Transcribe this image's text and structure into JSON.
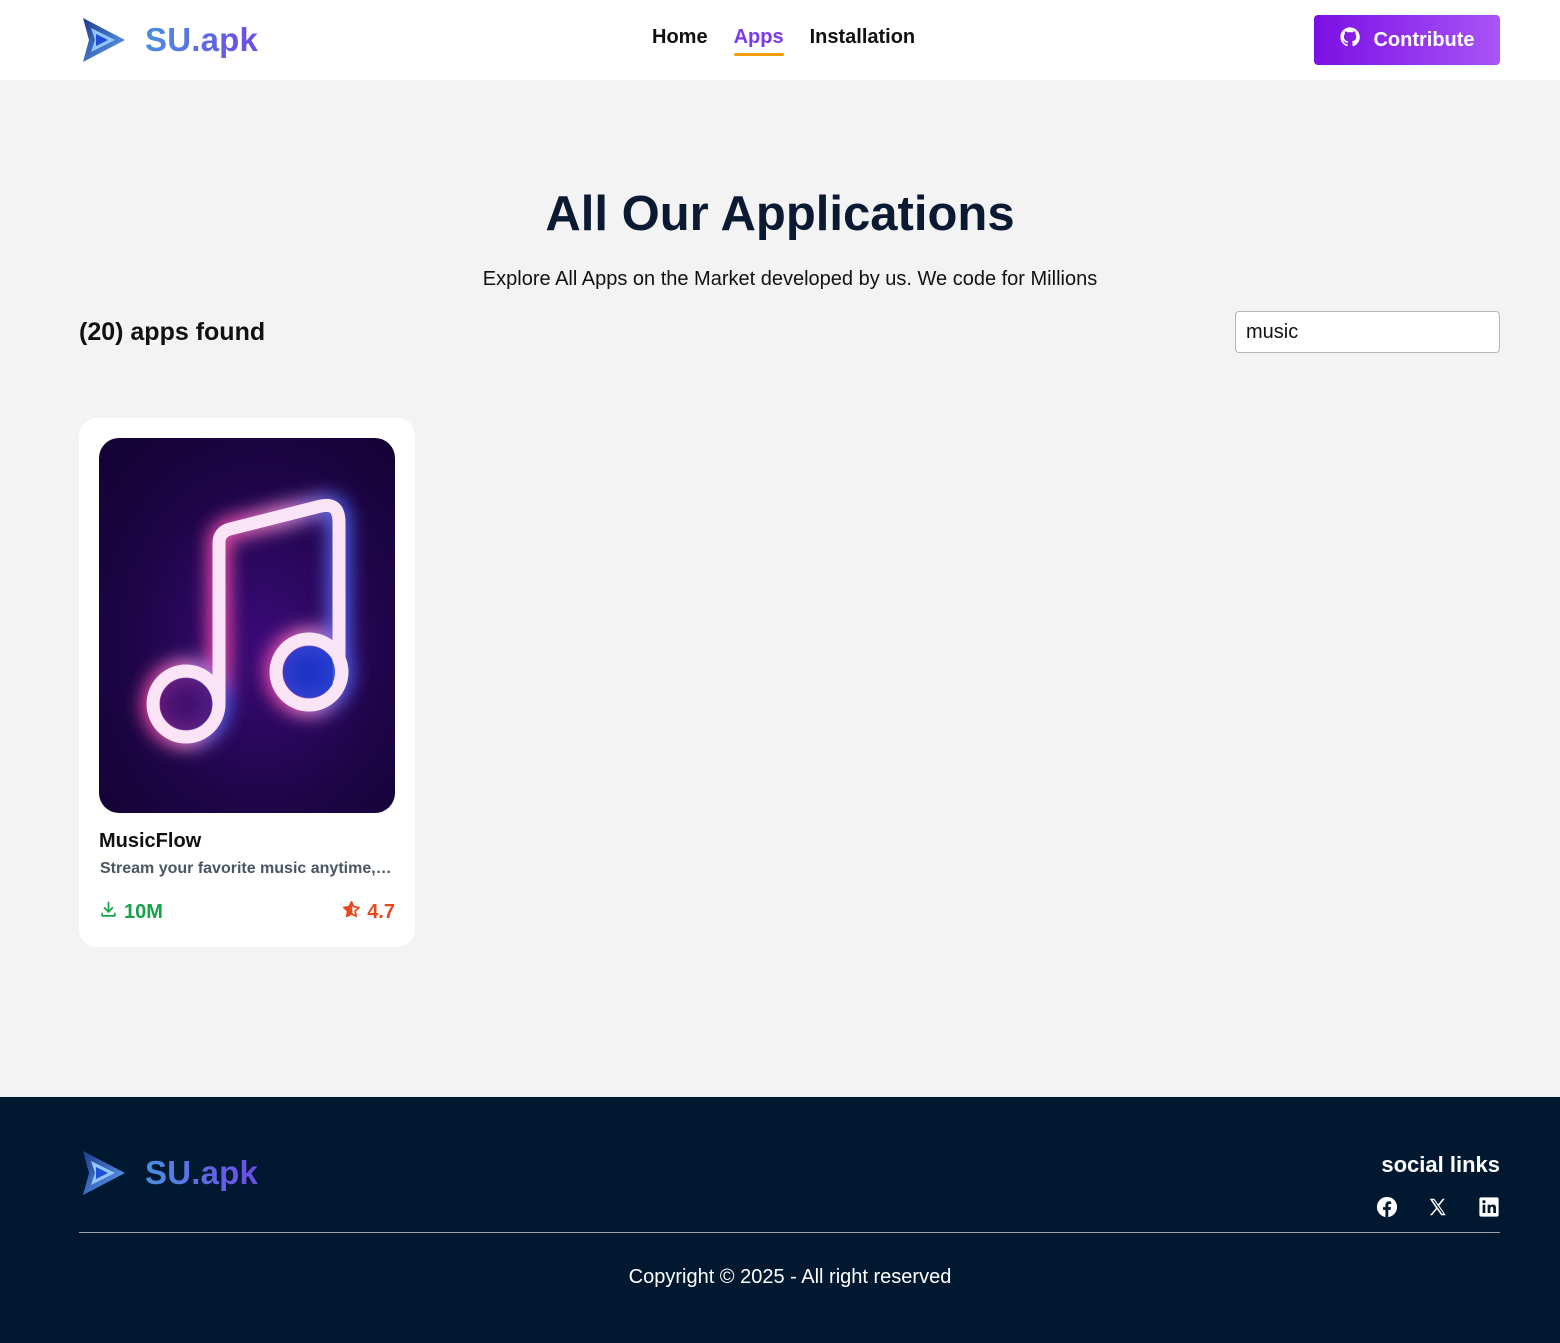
{
  "header": {
    "brand": "SU.apk",
    "nav": [
      {
        "label": "Home",
        "active": false
      },
      {
        "label": "Apps",
        "active": true
      },
      {
        "label": "Installation",
        "active": false
      }
    ],
    "contribute_label": "Contribute"
  },
  "main": {
    "title": "All Our Applications",
    "subtitle": "Explore All Apps on the Market developed by us. We code for Millions",
    "apps_found": "(20) apps found",
    "search": {
      "value": "music"
    },
    "apps": [
      {
        "name": "MusicFlow",
        "description": "Stream your favorite music anytime, anywhere",
        "downloads": "10M",
        "rating": "4.7"
      }
    ]
  },
  "footer": {
    "brand": "SU.apk",
    "social_title": "social links",
    "social": [
      "facebook-icon",
      "x-icon",
      "linkedin-icon"
    ],
    "copyright": "Copyright © 2025 - All right reserved"
  },
  "colors": {
    "accent": "#7c3aed",
    "active_underline": "#f59e0b",
    "downloads": "#16a34a",
    "rating": "#e64a19",
    "footer_bg": "#001931"
  }
}
